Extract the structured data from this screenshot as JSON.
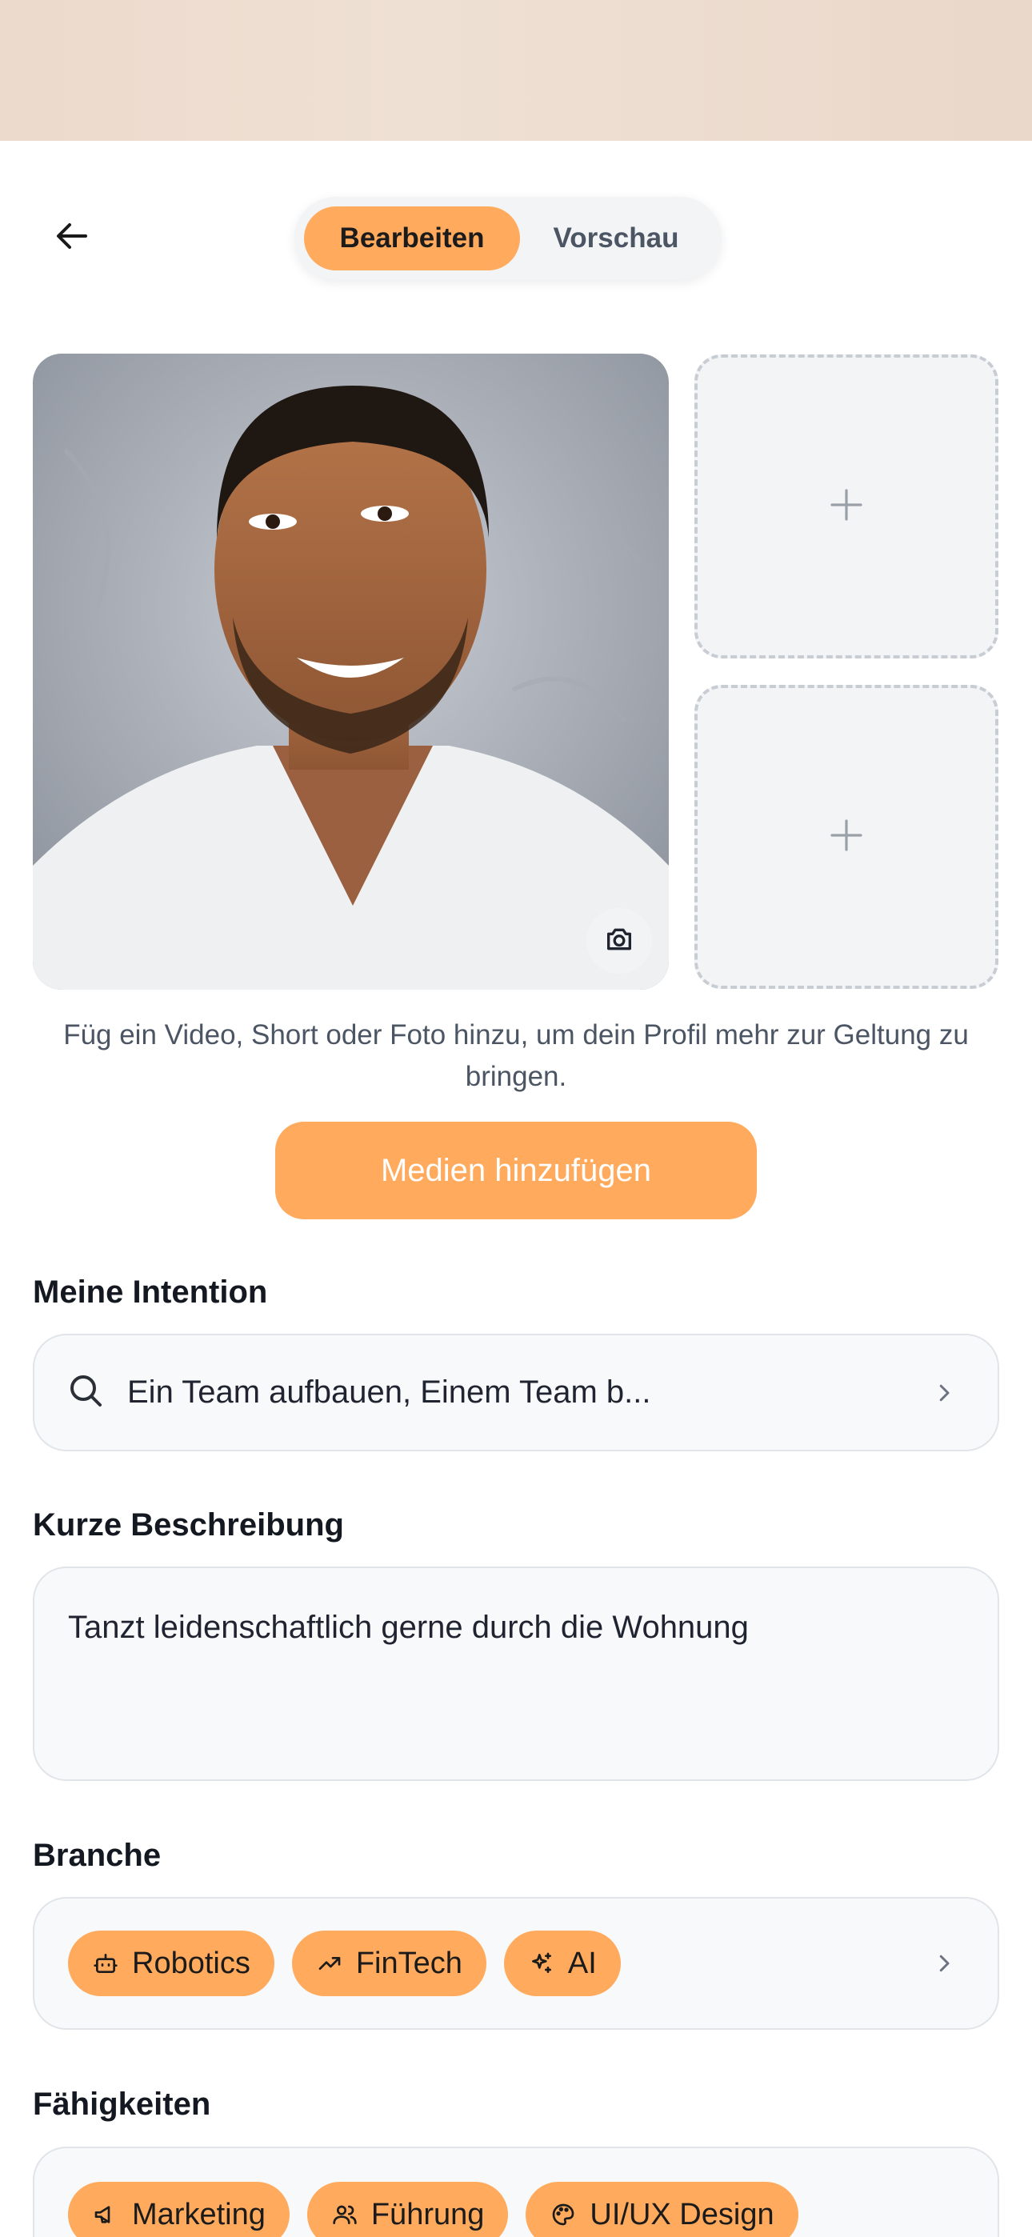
{
  "header": {
    "tabs": [
      {
        "label": "Bearbeiten",
        "active": true
      },
      {
        "label": "Vorschau",
        "active": false
      }
    ],
    "back_icon": "arrow-left-icon"
  },
  "media": {
    "hint": "Füg ein Video, Short oder Foto hinzu, um dein Profil mehr zur Geltung zu bringen.",
    "add_button": "Medien hinzufügen",
    "slot_icon": "plus-icon",
    "camera_icon": "camera-icon"
  },
  "intention": {
    "label": "Meine Intention",
    "value": "Ein Team aufbauen, Einem Team b..."
  },
  "description": {
    "label": "Kurze Beschreibung",
    "value": "Tanzt leidenschaftlich gerne durch die Wohnung"
  },
  "branche": {
    "label": "Branche",
    "chips": [
      {
        "label": "Robotics",
        "icon": "robot-icon"
      },
      {
        "label": "FinTech",
        "icon": "trending-up-icon"
      },
      {
        "label": "AI",
        "icon": "sparkles-icon"
      }
    ]
  },
  "faehigkeiten": {
    "label": "Fähigkeiten",
    "chips": [
      {
        "label": "Marketing",
        "icon": "megaphone-icon"
      },
      {
        "label": "Führung",
        "icon": "users-icon"
      },
      {
        "label": "UI/UX Design",
        "icon": "palette-icon"
      }
    ]
  },
  "colors": {
    "accent": "#ffaa5c",
    "top_band": "#ecdacc",
    "field_bg": "#f8f9fa",
    "field_border": "#e1e4e8"
  }
}
